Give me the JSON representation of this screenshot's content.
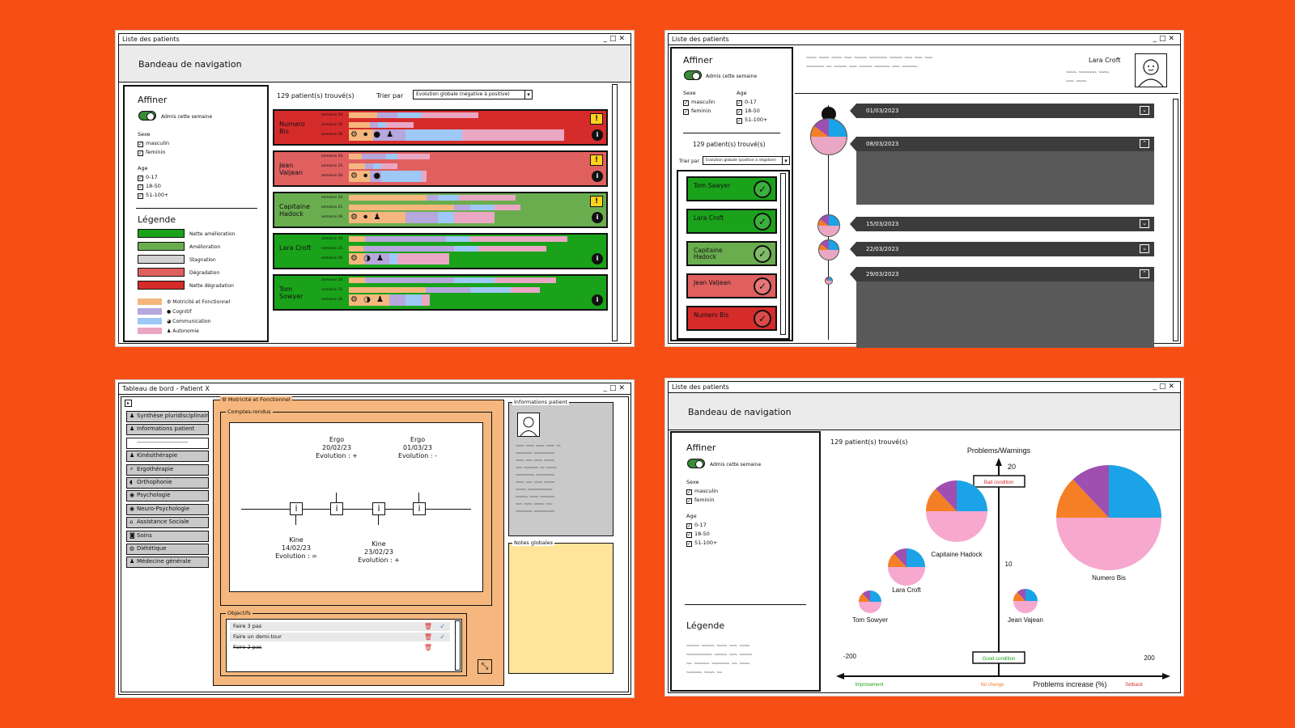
{
  "colors": {
    "background": "#f74e16",
    "nette_amelioration": "#1aa31a",
    "amelioration": "#6aad4f",
    "stagnation": "#d2d2d2",
    "degradation": "#e06060",
    "nette_degradation": "#d62b2b",
    "motricite": "#f5b77d",
    "cognitif": "#b6a7dd",
    "communication": "#9ec8f5",
    "autonomie": "#e9a7c3"
  },
  "win1": {
    "title": "Liste des patients",
    "nav": "Bandeau de navigation",
    "affiner": "Affiner",
    "toggle": "Admis cette semaine",
    "sexe": "Sexe",
    "sexes": [
      "masculin",
      "feminin"
    ],
    "age": "Age",
    "ages": [
      "0-17",
      "18-50",
      "51-100+"
    ],
    "legende": "Légende",
    "legend": [
      "Nette amélioration",
      "Amélioration",
      "Stagnation",
      "Dégradation",
      "Nette dégradation"
    ],
    "axes": [
      "Motricité et Fonctionnel",
      "Cognitif",
      "Communication",
      "Autonomie"
    ],
    "count": "129 patient(s) trouvé(s)",
    "sort_label": "Trier par",
    "sort_value": "Evolution globale (négative à positive)",
    "week_labels": [
      "semaine 24",
      "semaine 25",
      "semaine 26"
    ],
    "patients": [
      {
        "name": "Numero Bis",
        "status": "nette_degradation",
        "warn": "!"
      },
      {
        "name": "Jean Valjean",
        "status": "degradation",
        "warn": "!"
      },
      {
        "name": "Capitaine Hadock",
        "status": "amelioration",
        "warn": "!"
      },
      {
        "name": "Lara Croft",
        "status": "nette_amelioration",
        "warn": ""
      },
      {
        "name": "Tom Sowyer",
        "status": "nette_amelioration",
        "warn": ""
      }
    ],
    "info": "i"
  },
  "win2": {
    "title": "Liste des patients",
    "affiner": "Affiner",
    "toggle": "Admis cette semaine",
    "sexe": "Sexe",
    "sexes": [
      "masculin",
      "feminin"
    ],
    "age": "Age",
    "ages": [
      "0-17",
      "18-50",
      "51-100+"
    ],
    "count": "129 patient(s) trouvé(s)",
    "sort_label": "Trier par",
    "sort_value": "Evolution globale (positive à négative)",
    "patient_name": "Lara Croft",
    "cards": [
      {
        "name": "Tom Sawyer",
        "status": "nette_amelioration"
      },
      {
        "name": "Lara Croft",
        "status": "nette_amelioration"
      },
      {
        "name": "Capitaine Hadock",
        "status": "amelioration"
      },
      {
        "name": "Jean Valjean",
        "status": "degradation"
      },
      {
        "name": "Numero Bis",
        "status": "nette_degradation"
      }
    ],
    "check": "✓",
    "dates": [
      "01/03/2023",
      "08/03/2023",
      "15/03/2023",
      "22/03/2023",
      "29/03/2023"
    ]
  },
  "win3": {
    "title": "Tableau de bord - Patient X",
    "menu": [
      "Synthèse pluridisciplinaire",
      "Informations patient",
      "-------------------------",
      "Kinésithérapie",
      "Ergothérapie",
      "Orthophonie",
      "Psychologie",
      "Neuro-Psychologie",
      "Assistance Sociale",
      "Soins",
      "Diététique",
      "Médecine générale"
    ],
    "section": "Motricité et Fonctionnel",
    "comptes_rendus": "Comptes-rendus",
    "timeline_top": [
      {
        "who": "Ergo",
        "date": "20/02/23",
        "evo": "Evolution : +"
      },
      {
        "who": "Ergo",
        "date": "01/03/23",
        "evo": "Evolution : -"
      }
    ],
    "timeline_bottom": [
      {
        "who": "Kine",
        "date": "14/02/23",
        "evo": "Evolution : ="
      },
      {
        "who": "Kine",
        "date": "23/02/23",
        "evo": "Evolution : +"
      }
    ],
    "objectifs": "Objectifs",
    "todos": [
      "Faire 3 pas",
      "Faire un demi-tour",
      "Faire 2 pas"
    ],
    "infos_patient": "Informations patient",
    "notes": "Notes globales",
    "i": "i"
  },
  "win4": {
    "title": "Liste des patients",
    "nav": "Bandeau de navigation",
    "affiner": "Affiner",
    "toggle": "Admis cette semaine",
    "sexe": "Sexe",
    "sexes": [
      "masculin",
      "feminin"
    ],
    "age": "Age",
    "ages": [
      "0-17",
      "18-50",
      "51-100+"
    ],
    "legende": "Légende",
    "count": "129 patient(s) trouvé(s)",
    "y_title": "Problems/Warnings",
    "y_ticks": [
      "20",
      "10"
    ],
    "bad": "Bad condition",
    "good": "Good condition",
    "x_min": "-200",
    "x_max": "200",
    "x_title": "Problems increase (%)",
    "improvement": "Improvement",
    "no_change": "No change",
    "setback": "Setback",
    "bubbles": [
      "Capitaine Hadock",
      "Lara Croft",
      "Tom Sowyer",
      "Jean Vajean",
      "Numero Bis"
    ]
  },
  "scribble": "~~~~~ ~~~~~ ~~~~ ~~~"
}
